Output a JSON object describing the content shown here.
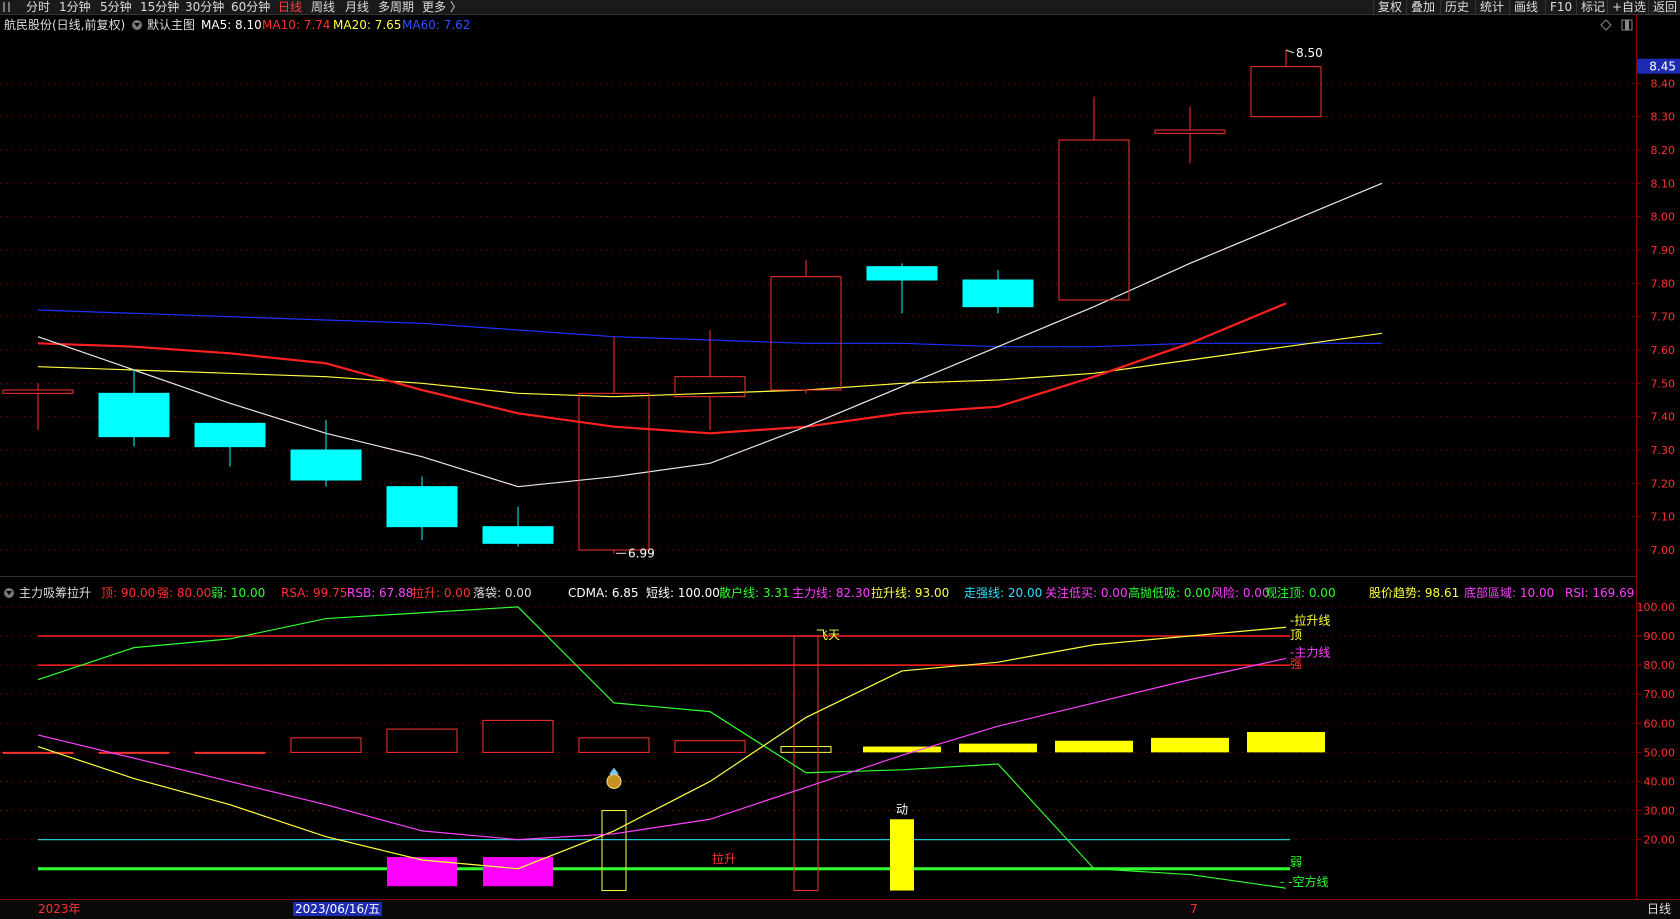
{
  "toolbar": {
    "periods": [
      "分时",
      "1分钟",
      "5分钟",
      "15分钟",
      "30分钟",
      "60分钟",
      "日线",
      "周线",
      "月线",
      "多周期",
      "更多 〉"
    ],
    "active_period": "日线",
    "right_buttons": [
      "复权",
      "叠加",
      "历史",
      "统计",
      "画线",
      "F10",
      "标记",
      "+自选",
      "返回"
    ]
  },
  "main_panel": {
    "title": "航民股份(日线,前复权)",
    "template": "默认主图",
    "ma_labels": [
      {
        "text": "MA5: 8.10",
        "color": "#ffffff"
      },
      {
        "text": "MA10: 7.74",
        "color": "#ff3030"
      },
      {
        "text": "MA20: 7.65",
        "color": "#ffff40"
      },
      {
        "text": "MA60: 7.62",
        "color": "#3050ff"
      }
    ],
    "current_price": "8.45",
    "high_label": "8.50",
    "low_label": "6.99",
    "price_ticks": [
      "8.40",
      "8.30",
      "8.20",
      "8.10",
      "8.00",
      "7.90",
      "7.80",
      "7.70",
      "7.60",
      "7.50",
      "7.40",
      "7.30",
      "7.20",
      "7.10",
      "7.00"
    ]
  },
  "indicator_panel": {
    "name": "主力吸筹拉升",
    "values": [
      {
        "text": "顶: 90.00",
        "color": "#ff3030"
      },
      {
        "text": "强: 80.00",
        "color": "#ff3030"
      },
      {
        "text": "弱: 10.00",
        "color": "#30ff30"
      },
      {
        "text": "RSA: 99.75",
        "color": "#ff3030"
      },
      {
        "text": "RSB: 67.88",
        "color": "#ff40ff"
      },
      {
        "text": "拉升: 0.00",
        "color": "#ff3030"
      },
      {
        "text": "落袋: 0.00",
        "color": "#dddddd"
      },
      {
        "text": "CDMA: 6.85",
        "color": "#ffffff"
      },
      {
        "text": "短线: 100.00",
        "color": "#ffffff"
      },
      {
        "text": "散户线: 3.31",
        "color": "#30ff30"
      },
      {
        "text": "主力线: 82.30",
        "color": "#ff40ff"
      },
      {
        "text": "拉升线: 93.00",
        "color": "#ffff40"
      },
      {
        "text": "走强线: 20.00",
        "color": "#30e0ff"
      },
      {
        "text": "关注低买: 0.00",
        "color": "#ff40ff"
      },
      {
        "text": "高抛低吸: 0.00",
        "color": "#30ff30"
      },
      {
        "text": "风险: 0.00",
        "color": "#ff40ff"
      },
      {
        "text": "观注顶: 0.00",
        "color": "#30ff30"
      },
      {
        "text": "股价趋势: 98.61",
        "color": "#ffff40"
      },
      {
        "text": "底部區域: 10.00",
        "color": "#ff40ff"
      },
      {
        "text": "RSI: 169.69",
        "color": "#ff40ff"
      }
    ],
    "ticks": [
      "100.00",
      "90.00",
      "80.00",
      "70.00",
      "60.00",
      "50.00",
      "40.00",
      "30.00",
      "20.00"
    ],
    "annotations": {
      "fly": "飞天",
      "pull": "拉升",
      "move": "动",
      "top": "顶",
      "strong": "强",
      "weak": "弱",
      "rise_line": "-拉升线",
      "main_line": "-主力线",
      "empty_line": "- -空方线"
    }
  },
  "bottom_bar": {
    "year_label": "2023年",
    "date_label": "2023/06/16/五",
    "month_marker": "7",
    "period": "日线"
  },
  "chart_data": {
    "type": "candlestick",
    "candles": [
      {
        "open": 7.48,
        "high": 7.5,
        "low": 7.36,
        "close": 7.47,
        "color": "red"
      },
      {
        "open": 7.47,
        "high": 7.54,
        "low": 7.31,
        "close": 7.34,
        "color": "cyan"
      },
      {
        "open": 7.38,
        "high": 7.38,
        "low": 7.25,
        "close": 7.31,
        "color": "cyan"
      },
      {
        "open": 7.3,
        "high": 7.39,
        "low": 7.19,
        "close": 7.21,
        "color": "cyan"
      },
      {
        "open": 7.19,
        "high": 7.22,
        "low": 7.03,
        "close": 7.07,
        "color": "cyan"
      },
      {
        "open": 7.07,
        "high": 7.13,
        "low": 7.01,
        "close": 7.02,
        "color": "cyan"
      },
      {
        "open": 7.0,
        "high": 7.64,
        "low": 6.99,
        "close": 7.47,
        "color": "red"
      },
      {
        "open": 7.46,
        "high": 7.66,
        "low": 7.36,
        "close": 7.52,
        "color": "red"
      },
      {
        "open": 7.48,
        "high": 7.87,
        "low": 7.47,
        "close": 7.82,
        "color": "red"
      },
      {
        "open": 7.85,
        "high": 7.86,
        "low": 7.71,
        "close": 7.81,
        "color": "cyan"
      },
      {
        "open": 7.81,
        "high": 7.84,
        "low": 7.71,
        "close": 7.73,
        "color": "cyan"
      },
      {
        "open": 7.75,
        "high": 8.36,
        "low": 7.75,
        "close": 8.23,
        "color": "red"
      },
      {
        "open": 8.25,
        "high": 8.33,
        "low": 8.16,
        "close": 8.26,
        "color": "red"
      },
      {
        "open": 8.3,
        "high": 8.5,
        "low": 8.3,
        "close": 8.45,
        "color": "red"
      }
    ],
    "ma5": [
      7.64,
      7.54,
      7.44,
      7.35,
      7.28,
      7.19,
      7.22,
      7.26,
      7.37,
      7.49,
      7.61,
      7.73,
      7.86,
      7.98,
      8.1
    ],
    "ma10": [
      7.62,
      7.61,
      7.59,
      7.56,
      7.48,
      7.41,
      7.37,
      7.35,
      7.37,
      7.41,
      7.43,
      7.52,
      7.62,
      7.74
    ],
    "ma20": [
      7.55,
      7.54,
      7.53,
      7.52,
      7.5,
      7.47,
      7.46,
      7.47,
      7.48,
      7.5,
      7.51,
      7.53,
      7.57,
      7.61,
      7.65
    ],
    "ma60": [
      7.72,
      7.71,
      7.7,
      7.69,
      7.68,
      7.66,
      7.64,
      7.63,
      7.62,
      7.62,
      7.61,
      7.61,
      7.62,
      7.62,
      7.62
    ],
    "ylim": [
      6.94,
      8.53
    ],
    "indicator": {
      "ylim": [
        2,
        101
      ],
      "green_line": [
        75,
        86,
        89,
        96,
        98,
        100,
        67,
        64,
        43,
        44,
        46,
        10,
        8,
        3.31
      ],
      "yellow_line": [
        52,
        41,
        32,
        21,
        13,
        10,
        23,
        40,
        62,
        78,
        81,
        87,
        90,
        93
      ],
      "magenta_line": [
        56,
        48,
        40,
        32,
        23,
        20,
        22,
        27,
        38,
        49,
        59,
        67,
        75,
        82.3
      ],
      "red_boxes": [
        [
          50,
          50
        ],
        [
          50,
          50
        ],
        [
          50,
          50
        ],
        [
          50,
          55
        ],
        [
          50,
          58
        ],
        [
          50,
          61
        ],
        [
          50,
          55
        ],
        [
          50,
          54
        ]
      ],
      "yellow_bars": [
        [
          50,
          52
        ],
        [
          50,
          53
        ],
        [
          50,
          54
        ],
        [
          50,
          55
        ],
        [
          50,
          57
        ]
      ],
      "magenta_blocks": [
        [
          4,
          14
        ],
        [
          4,
          14
        ]
      ],
      "lines": {
        "top": 90,
        "strong": 80,
        "mid": 50,
        "cyan": 20,
        "weak": 10
      }
    }
  }
}
